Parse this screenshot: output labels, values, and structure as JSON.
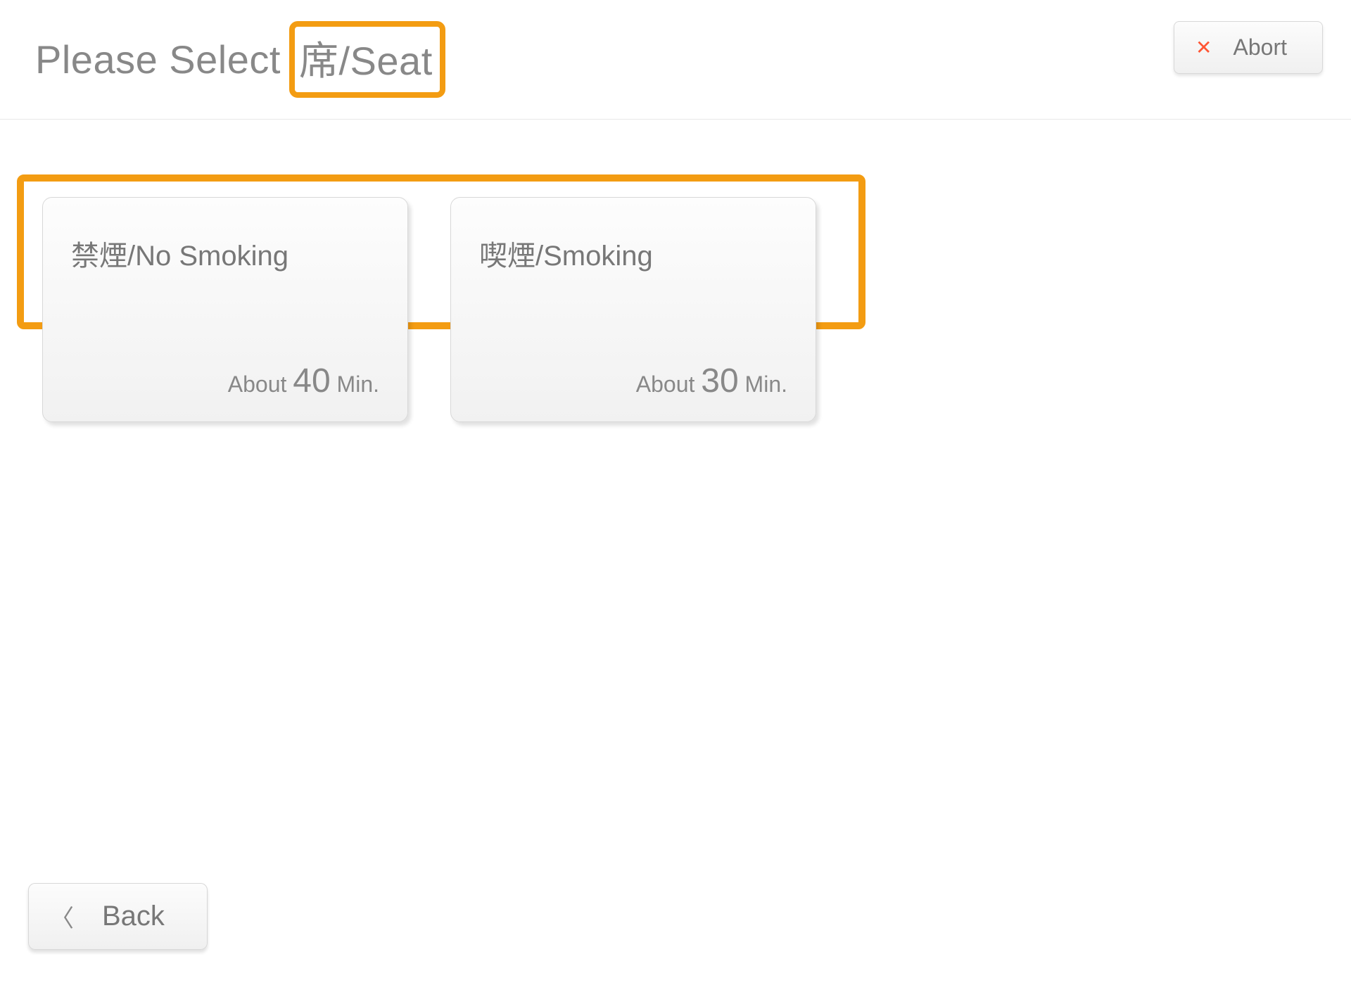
{
  "header": {
    "title_prefix": "Please Select",
    "title_highlight": "席/Seat",
    "abort_label": "Abort"
  },
  "options": [
    {
      "label": "禁煙/No Smoking",
      "wait_prefix": "About ",
      "wait_value": "40",
      "wait_suffix": " Min."
    },
    {
      "label": "喫煙/Smoking",
      "wait_prefix": "About ",
      "wait_value": "30",
      "wait_suffix": " Min."
    }
  ],
  "footer": {
    "back_label": "Back"
  },
  "annotations": {
    "highlight_color": "#f39c12"
  }
}
